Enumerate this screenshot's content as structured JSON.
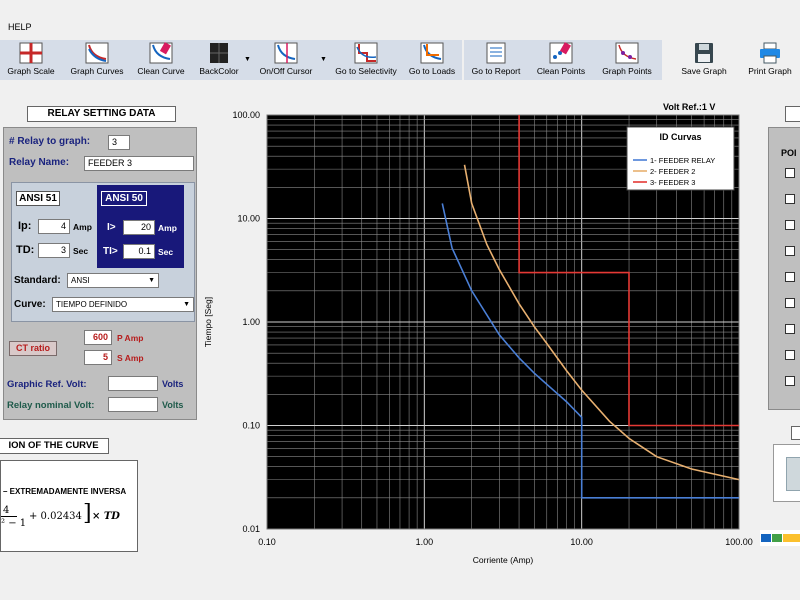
{
  "menu": {
    "help": "HELP"
  },
  "toolbar": {
    "graph_scale": "Graph Scale",
    "graph_curves": "Graph Curves",
    "clean_curve": "Clean Curve",
    "back_color": "BackColor",
    "on_off_cursor": "On/Off Cursor",
    "go_to_selectivity": "Go to Selectivity",
    "go_to_loads": "Go to Loads",
    "go_to_report": "Go to Report",
    "clean_points": "Clean Points",
    "graph_points": "Graph  Points",
    "save_graph": "Save Graph",
    "print_graph": "Print  Graph"
  },
  "relay": {
    "title": "RELAY SETTING DATA",
    "relay_to_graph_label": "# Relay to graph:",
    "relay_to_graph_value": "3",
    "relay_name_label": "Relay Name:",
    "relay_name_value": "FEEDER 3",
    "ansi51": {
      "label": "ANSI 51",
      "ip_label": "Ip:",
      "ip_value": "4",
      "ip_unit": "Amp",
      "td_label": "TD:",
      "td_value": "3",
      "td_unit": "Sec"
    },
    "ansi50": {
      "label": "ANSI 50",
      "i_label": "I>",
      "i_value": "20",
      "i_unit": "Amp",
      "ti_label": "TI>",
      "ti_value": "0.1",
      "ti_unit": "Sec"
    },
    "standard_label": "Standard:",
    "standard_value": "ANSI",
    "curve_label": "Curve:",
    "curve_value": "TIEMPO DEFINIDO",
    "ct_ratio_label": "CT ratio",
    "ct_p_value": "600",
    "ct_p_unit": "P Amp",
    "ct_s_value": "5",
    "ct_s_unit": "S Amp",
    "graphic_ref_volt_label": "Graphic Ref. Volt:",
    "graphic_ref_volt_value": "",
    "graphic_ref_volt_unit": "Volts",
    "relay_nominal_volt_label": "Relay nominal Volt:",
    "relay_nominal_volt_value": "",
    "relay_nominal_volt_unit": "Volts"
  },
  "curve_desc": {
    "title": "ION OF THE CURVE",
    "name": "– EXTREMADAMENTE INVERSA",
    "formula_frac_top": "4",
    "formula_frac_bottom": "² − 1",
    "formula_rest": "+ 0.02434",
    "formula_times": "× TD"
  },
  "right_panel": {
    "title": "POI"
  },
  "chart_data": {
    "type": "line",
    "title": "",
    "ref_label": "Volt Ref.:1 V",
    "xlabel": "Corriente (Amp)",
    "ylabel": "Tiempo [Seg]",
    "x_scale": "log",
    "y_scale": "log",
    "xlim": [
      0.1,
      100
    ],
    "ylim": [
      0.01,
      100
    ],
    "x_ticks": [
      "0.10",
      "1.00",
      "10.00",
      "100.00"
    ],
    "y_ticks": [
      "100.00",
      "10.00",
      "1.00",
      "0.10",
      "0.01"
    ],
    "grid": true,
    "background": "#000000",
    "legend_title": "ID Curvas",
    "legend_position": "top-right",
    "series": [
      {
        "name": "1- FEEDER RELAY",
        "color": "#4a7fd6",
        "x": [
          1.3,
          1.5,
          2,
          3,
          4,
          5,
          6,
          8,
          10,
          10,
          20,
          50,
          100
        ],
        "y": [
          14,
          5.2,
          2.0,
          0.75,
          0.45,
          0.32,
          0.25,
          0.17,
          0.12,
          0.02,
          0.02,
          0.02,
          0.02
        ]
      },
      {
        "name": "2- FEEDER 2",
        "color": "#e8b070",
        "x": [
          1.8,
          2,
          2.5,
          3,
          4,
          5,
          6,
          8,
          10,
          15,
          20,
          30,
          50,
          100
        ],
        "y": [
          33,
          14,
          5.6,
          3.2,
          1.5,
          0.9,
          0.62,
          0.34,
          0.22,
          0.11,
          0.075,
          0.05,
          0.038,
          0.03
        ]
      },
      {
        "name": "3- FEEDER 3",
        "color": "#e53935",
        "x": [
          4,
          4,
          20,
          20,
          100
        ],
        "y": [
          100,
          3.0,
          3.0,
          0.1,
          0.1
        ]
      }
    ]
  }
}
